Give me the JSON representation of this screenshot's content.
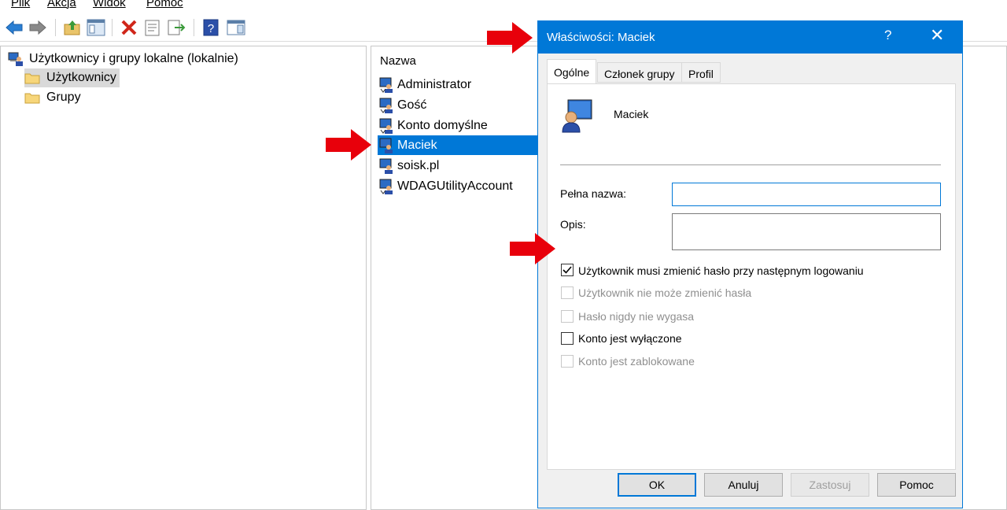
{
  "menu": [
    "Plik",
    "Akcja",
    "Widok",
    "Pomoc"
  ],
  "toolbar": {
    "icons": [
      "back-arrow-icon",
      "forward-arrow-icon",
      "up-folder-icon",
      "show-hide-tree-icon",
      "delete-icon",
      "properties-icon",
      "export-list-icon",
      "help-icon",
      "action-pane-icon"
    ]
  },
  "tree": {
    "root": "Użytkownicy i grupy lokalne (lokalnie)",
    "children": [
      "Użytkownicy",
      "Grupy"
    ],
    "selected": "Użytkownicy"
  },
  "list": {
    "column": "Nazwa",
    "items": [
      "Administrator",
      "Gość",
      "Konto domyślne",
      "Maciek",
      "soisk.pl",
      "WDAGUtilityAccount"
    ],
    "selected": "Maciek"
  },
  "dialog": {
    "title": "Właściwości: Maciek",
    "help_glyph": "?",
    "close_glyph": "✕",
    "tabs": [
      "Ogólne",
      "Członek grupy",
      "Profil"
    ],
    "active_tab": "Ogólne",
    "user_name": "Maciek",
    "full_name_label": "Pełna nazwa:",
    "full_name_value": "",
    "description_label": "Opis:",
    "description_value": "",
    "checkboxes": [
      {
        "label": "Użytkownik musi zmienić hasło przy następnym logowaniu",
        "checked": true,
        "enabled": true
      },
      {
        "label": "Użytkownik nie może zmienić hasła",
        "checked": false,
        "enabled": false
      },
      {
        "label": "Hasło nigdy nie wygasa",
        "checked": false,
        "enabled": false
      },
      {
        "label": "Konto jest wyłączone",
        "checked": false,
        "enabled": true
      },
      {
        "label": "Konto jest zablokowane",
        "checked": false,
        "enabled": false
      }
    ],
    "buttons": {
      "ok": "OK",
      "cancel": "Anuluj",
      "apply": "Zastosuj",
      "help": "Pomoc"
    }
  },
  "colors": {
    "accent": "#0078d7",
    "annotation_arrow": "#e8000b"
  }
}
